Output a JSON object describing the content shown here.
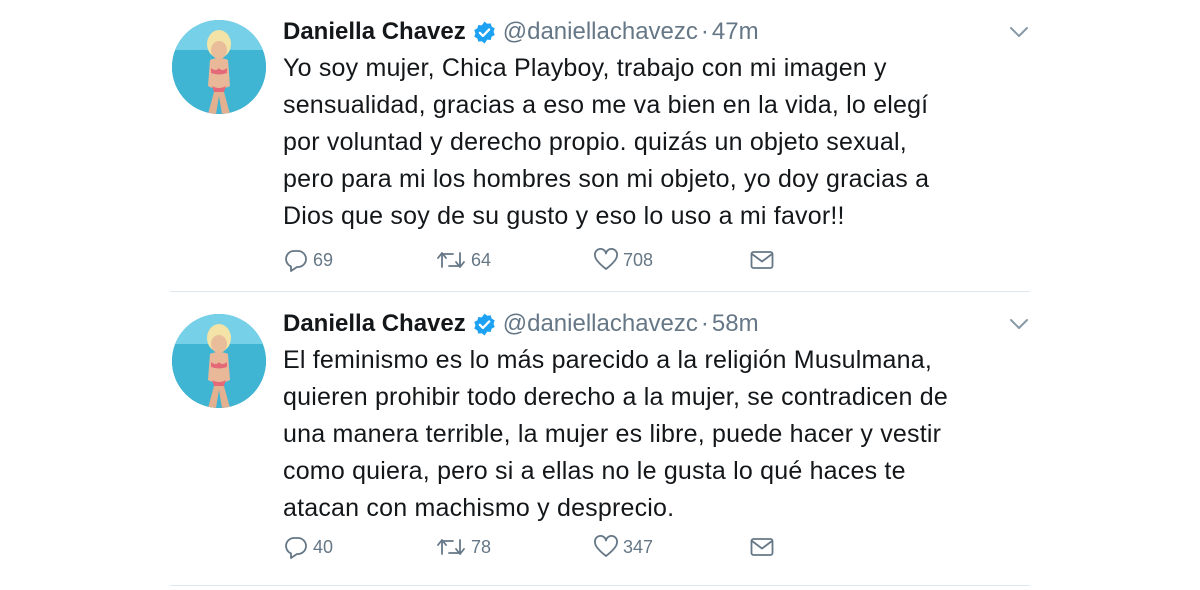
{
  "icons": {
    "verified": "verified-badge-icon",
    "caret": "chevron-down-icon",
    "reply": "reply-icon",
    "retweet": "retweet-icon",
    "like": "heart-icon",
    "dm": "envelope-icon"
  },
  "colors": {
    "verified_blue": "#1da1f2",
    "text_primary": "#14171a",
    "text_secondary": "#657786",
    "divider": "#e1e8ed"
  },
  "tweets": [
    {
      "display_name": "Daniella Chavez",
      "handle": "@daniellachavezc",
      "separator": "·",
      "time": "47m",
      "text_lines": [
        "Yo soy mujer, Chica Playboy, trabajo con mi imagen y",
        "sensualidad, gracias a eso me va bien en la vida, lo elegí",
        "por voluntad y derecho propio.  quizás un objeto sexual,",
        "pero para mi los hombres son mi objeto,  yo doy gracias a",
        "Dios que soy de su gusto y eso lo uso a mi favor!!"
      ],
      "replies": "69",
      "retweets": "64",
      "likes": "708"
    },
    {
      "display_name": "Daniella Chavez",
      "handle": "@daniellachavezc",
      "separator": "·",
      "time": "58m",
      "text_lines": [
        "El feminismo es lo más parecido a la religión Musulmana,",
        "quieren prohibir todo derecho a la mujer, se contradicen de",
        "una manera terrible, la mujer es libre, puede hacer y vestir",
        "como quiera, pero si a ellas no le gusta lo qué haces te",
        "atacan con machismo y desprecio."
      ],
      "replies": "40",
      "retweets": "78",
      "likes": "347"
    }
  ]
}
